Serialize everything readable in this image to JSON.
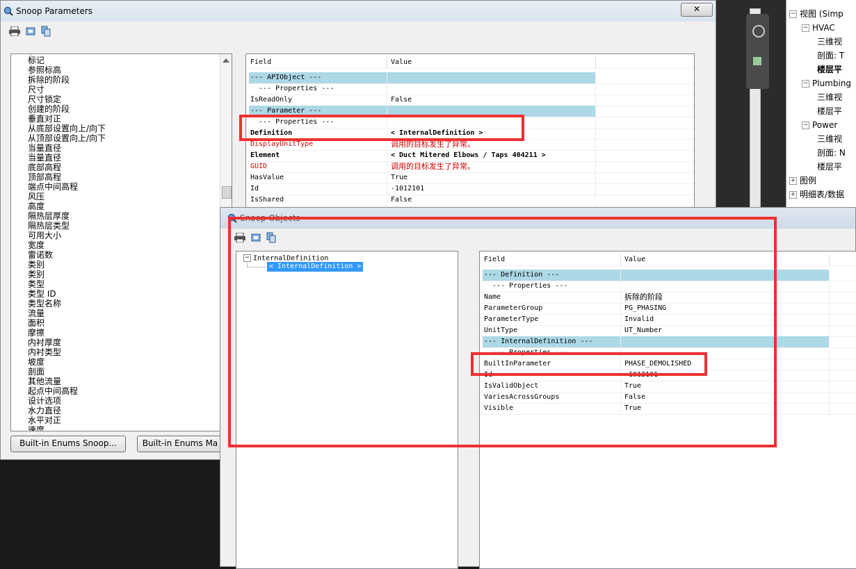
{
  "background": {
    "browser_items": [
      {
        "label": "视图 (Simp",
        "expander": "⊟"
      },
      {
        "label": "HVAC",
        "expander": "⊟"
      },
      {
        "label": "三维视"
      },
      {
        "label": "剖面: T"
      },
      {
        "label": "楼层平"
      },
      {
        "label": "Plumbing",
        "expander": "⊟"
      },
      {
        "label": "三维视"
      },
      {
        "label": "楼层平"
      },
      {
        "label": "Power",
        "expander": "⊟"
      },
      {
        "label": "三维视"
      },
      {
        "label": "剖面: N"
      },
      {
        "label": "楼层平"
      },
      {
        "label": "图例",
        "expander": "⊞"
      },
      {
        "label": "明细表/数据",
        "expander": "⊞"
      }
    ]
  },
  "win1": {
    "title": "Snoop Parameters",
    "close_label": "✕",
    "list_items": [
      "标记",
      "参照标高",
      "拆除的阶段",
      "尺寸",
      "尺寸锁定",
      "创建的阶段",
      "垂直对正",
      "从底部设置向上/向下",
      "从顶部设置向上/向下",
      "当量直径",
      "当量直径",
      "底部高程",
      "顶部高程",
      "端点中间高程",
      "风压",
      "高度",
      "隔热层厚度",
      "隔热层类型",
      "可用大小",
      "宽度",
      "雷诺数",
      "类别",
      "类别",
      "类型",
      "类型 ID",
      "类型名称",
      "流量",
      "面积",
      "摩擦",
      "内衬厚度",
      "内衬类型",
      "坡度",
      "剖面",
      "其他流量",
      "起点中间高程",
      "设计选项",
      "水力直径",
      "水平对正",
      "速度"
    ],
    "grid_header": {
      "field": "Field",
      "value": "Value"
    },
    "grid_rows": [
      {
        "field": "--- APIObject ---",
        "value": "",
        "kind": "section"
      },
      {
        "field": "  --- Properties ---",
        "value": "",
        "kind": "sub"
      },
      {
        "field": "IsReadOnly",
        "value": "False",
        "kind": "normal"
      },
      {
        "field": "--- Parameter ---",
        "value": "",
        "kind": "section"
      },
      {
        "field": "  --- Properties ---",
        "value": "",
        "kind": "sub"
      },
      {
        "field": "Definition",
        "value": "< InternalDefinition >",
        "kind": "bold"
      },
      {
        "field": "DisplayUnitType",
        "value": "调用的目标发生了异常。",
        "kind": "error"
      },
      {
        "field": "Element",
        "value": "< Duct  Mitered Elbows / Taps  404211 >",
        "kind": "bold"
      },
      {
        "field": "GUID",
        "value": "调用的目标发生了异常。",
        "kind": "error"
      },
      {
        "field": "HasValue",
        "value": "True",
        "kind": "normal"
      },
      {
        "field": "Id",
        "value": "-1012101",
        "kind": "normal"
      },
      {
        "field": "IsShared",
        "value": "False",
        "kind": "normal"
      }
    ],
    "buttons": {
      "builtin_snoop": "Built-in Enums Snoop...",
      "builtin_map": "Built-in Enums Ma"
    }
  },
  "win2": {
    "title": "Snoop Objects",
    "tree_root": "InternalDefinition",
    "tree_child": "< InternalDefinition >",
    "grid_header": {
      "field": "Field",
      "value": "Value"
    },
    "grid_rows": [
      {
        "field": "--- Definition ---",
        "value": "",
        "kind": "section"
      },
      {
        "field": "  --- Properties ---",
        "value": "",
        "kind": "sub"
      },
      {
        "field": "Name",
        "value": "拆除的阶段",
        "kind": "normal"
      },
      {
        "field": "ParameterGroup",
        "value": "PG_PHASING",
        "kind": "normal"
      },
      {
        "field": "ParameterType",
        "value": "Invalid",
        "kind": "normal"
      },
      {
        "field": "UnitType",
        "value": "UT_Number",
        "kind": "normal"
      },
      {
        "field": "--- InternalDefinition ---",
        "value": "",
        "kind": "section"
      },
      {
        "field": "  --- Properties ---",
        "value": "",
        "kind": "sub"
      },
      {
        "field": "BuiltInParameter",
        "value": "PHASE_DEMOLISHED",
        "kind": "normal"
      },
      {
        "field": "Id",
        "value": "-1012101",
        "kind": "normal"
      },
      {
        "field": "IsValidObject",
        "value": "True",
        "kind": "normal"
      },
      {
        "field": "VariesAcrossGroups",
        "value": "False",
        "kind": "normal"
      },
      {
        "field": "Visible",
        "value": "True",
        "kind": "normal"
      }
    ]
  },
  "colors": {
    "highlight": "#ee3030",
    "section": "#add8e6",
    "error": "#d00000",
    "selection": "#3399ff"
  }
}
